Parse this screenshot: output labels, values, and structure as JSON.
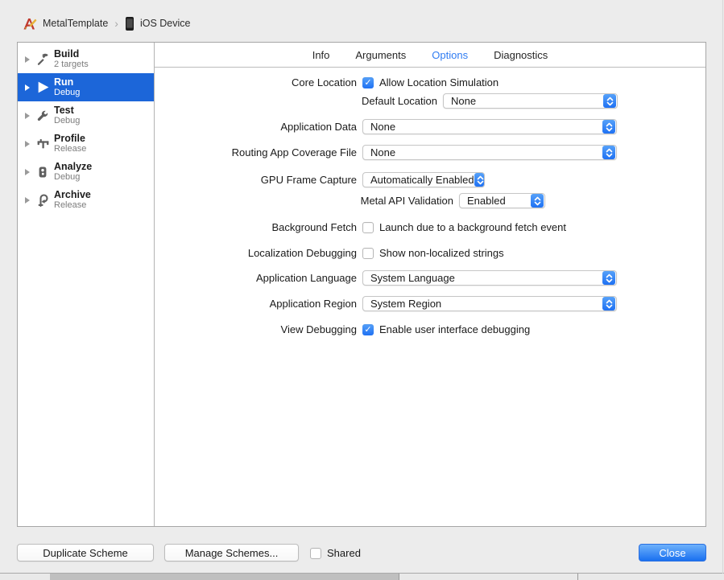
{
  "breadcrumb": {
    "scheme": "MetalTemplate",
    "separator": "›",
    "destination": "iOS Device"
  },
  "sidebar": {
    "items": [
      {
        "label": "Build",
        "sublabel": "2 targets",
        "icon": "hammer-icon",
        "selected": false
      },
      {
        "label": "Run",
        "sublabel": "Debug",
        "icon": "play-icon",
        "selected": true
      },
      {
        "label": "Test",
        "sublabel": "Debug",
        "icon": "wrench-icon",
        "selected": false
      },
      {
        "label": "Profile",
        "sublabel": "Release",
        "icon": "gauge-icon",
        "selected": false
      },
      {
        "label": "Analyze",
        "sublabel": "Debug",
        "icon": "analyze-icon",
        "selected": false
      },
      {
        "label": "Archive",
        "sublabel": "Release",
        "icon": "archive-icon",
        "selected": false
      }
    ]
  },
  "tabs": [
    {
      "label": "Info",
      "selected": false
    },
    {
      "label": "Arguments",
      "selected": false
    },
    {
      "label": "Options",
      "selected": true
    },
    {
      "label": "Diagnostics",
      "selected": false
    }
  ],
  "form": {
    "rows": [
      {
        "label": "Core Location",
        "control": "checkbox",
        "checked": true,
        "text": "Allow Location Simulation"
      },
      {
        "label": "Default Location",
        "control": "popup",
        "value": "None"
      },
      {
        "label": "Application Data",
        "control": "popup",
        "value": "None"
      },
      {
        "label": "Routing App Coverage File",
        "control": "popup",
        "value": "None"
      },
      {
        "label": "GPU Frame Capture",
        "control": "popup",
        "value": "Automatically Enabled"
      },
      {
        "label": "Metal API Validation",
        "control": "popup",
        "value": "Enabled"
      },
      {
        "label": "Background Fetch",
        "control": "checkbox",
        "checked": false,
        "text": "Launch due to a background fetch event"
      },
      {
        "label": "Localization Debugging",
        "control": "checkbox",
        "checked": false,
        "text": "Show non-localized strings"
      },
      {
        "label": "Application Language",
        "control": "popup",
        "value": "System Language"
      },
      {
        "label": "Application Region",
        "control": "popup",
        "value": "System Region"
      },
      {
        "label": "View Debugging",
        "control": "checkbox",
        "checked": true,
        "text": "Enable user interface debugging"
      }
    ]
  },
  "footer": {
    "duplicate_label": "Duplicate Scheme",
    "manage_label": "Manage Schemes...",
    "shared_label": "Shared",
    "shared_checked": false,
    "close_label": "Close"
  },
  "colors": {
    "selection_blue": "#1c66d9",
    "tab_selected_blue": "#2f7cf2",
    "control_blue_top": "#56a1f9",
    "control_blue_bottom": "#1f71f3",
    "dialog_background": "#ececec"
  }
}
